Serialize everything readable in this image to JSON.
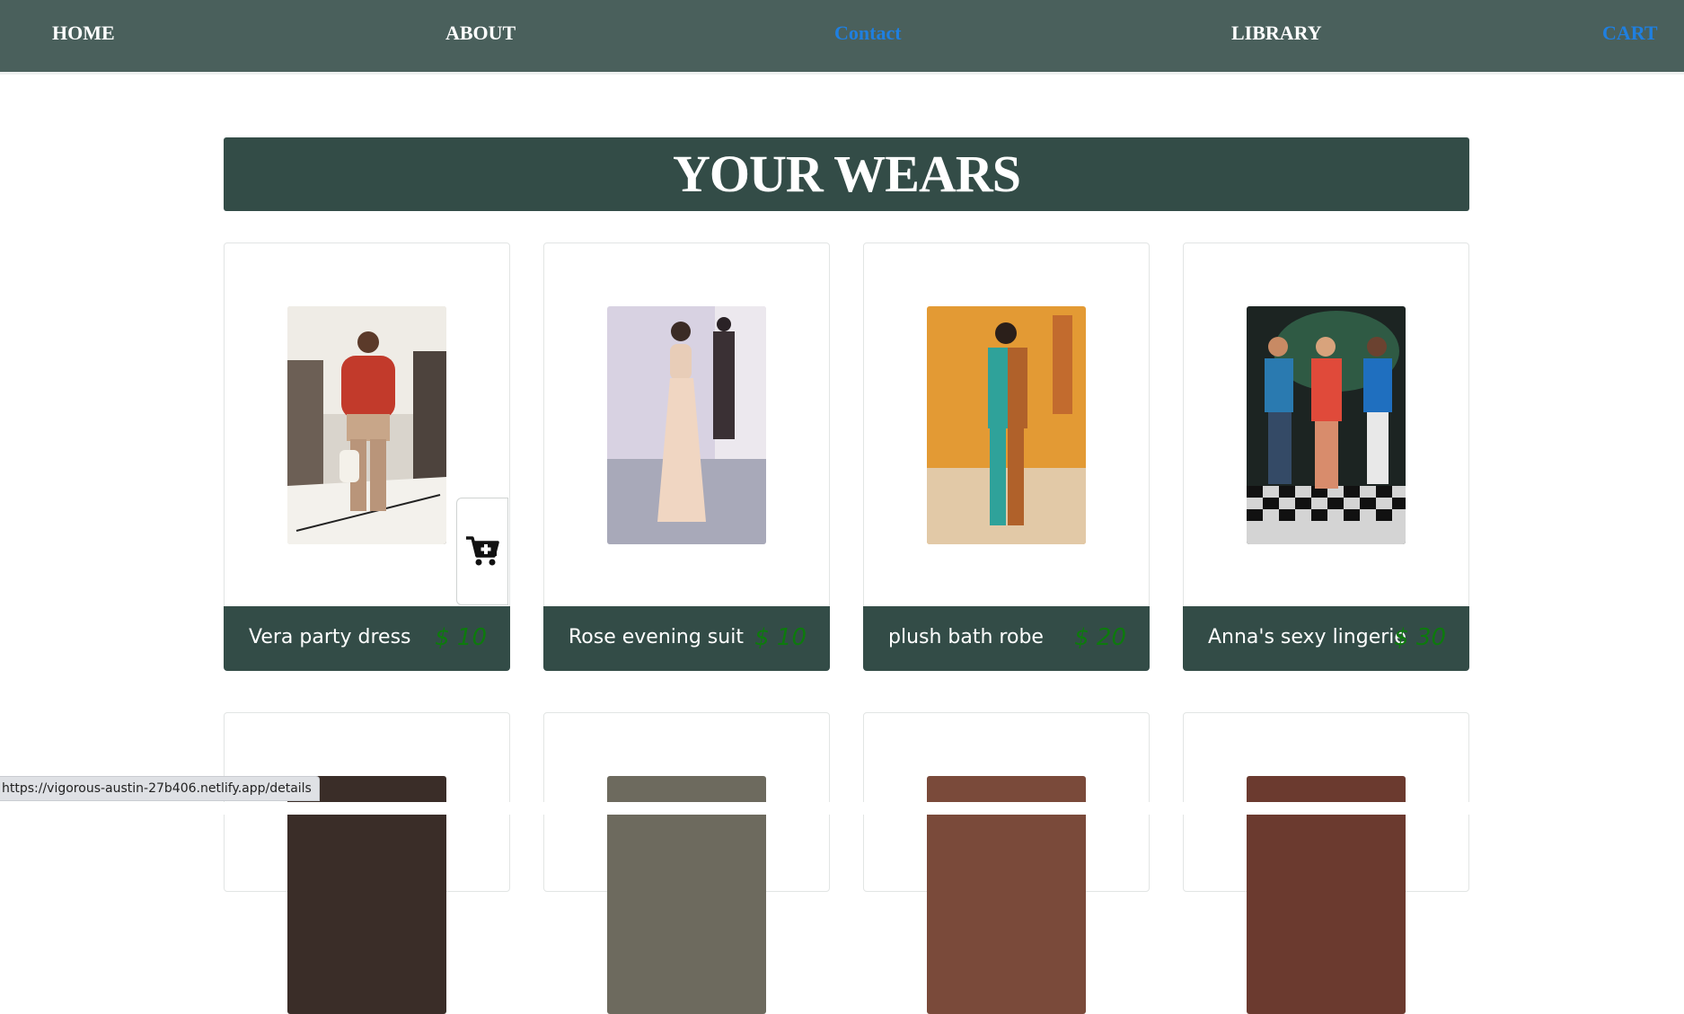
{
  "nav": {
    "items": [
      {
        "label": "HOME"
      },
      {
        "label": "ABOUT"
      },
      {
        "label": "Contact"
      },
      {
        "label": "LIBRARY"
      },
      {
        "label": "CART"
      }
    ]
  },
  "hero": {
    "title": "YOUR WEARS"
  },
  "products": [
    {
      "name": "Vera party dress",
      "price": "$ 10"
    },
    {
      "name": "Rose evening suit",
      "price": "$ 10"
    },
    {
      "name": "plush bath robe",
      "price": "$ 20"
    },
    {
      "name": "Anna's sexy lingerie",
      "price": "$ 30"
    }
  ],
  "status": {
    "url": "https://vigorous-austin-27b406.netlify.app/details"
  },
  "colors": {
    "nav_bg": "#4a605c",
    "accent_link": "#1f7fe0",
    "banner_bg": "#334c47",
    "price_green": "#0d7a0d"
  }
}
